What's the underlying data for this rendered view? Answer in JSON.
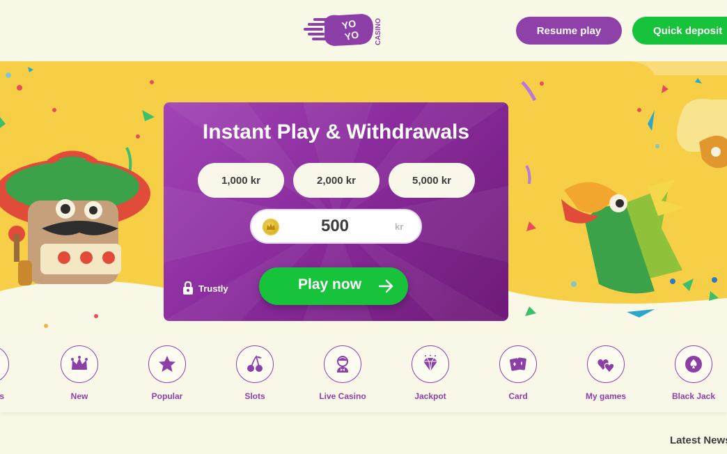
{
  "header": {
    "logo": {
      "word_top": "YO",
      "word_bottom": "YO",
      "casino": "CASINO"
    },
    "resume_label": "Resume play",
    "deposit_label": "Quick deposit"
  },
  "hero": {
    "title": "Instant Play & Withdrawals",
    "amounts": [
      "1,000 kr",
      "2,000 kr",
      "5,000 kr"
    ],
    "input_value": "500",
    "input_unit": "kr",
    "payment_provider": "Trustly",
    "play_label": "Play now"
  },
  "categories": [
    {
      "label": "Games",
      "icon": "games-icon"
    },
    {
      "label": "New",
      "icon": "crown-icon"
    },
    {
      "label": "Popular",
      "icon": "star-icon"
    },
    {
      "label": "Slots",
      "icon": "cherry-icon"
    },
    {
      "label": "Live Casino",
      "icon": "dealer-icon"
    },
    {
      "label": "Jackpot",
      "icon": "diamond-icon"
    },
    {
      "label": "Card",
      "icon": "cards-icon"
    },
    {
      "label": "My games",
      "icon": "hearts-icon"
    },
    {
      "label": "Black Jack",
      "icon": "spade-icon"
    }
  ],
  "latest_news_label": "Latest News",
  "colors": {
    "brand_purple": "#8e41a9",
    "action_green": "#16c33a",
    "hero_yellow": "#f6cf47",
    "page_cream": "#f9f8e6"
  }
}
